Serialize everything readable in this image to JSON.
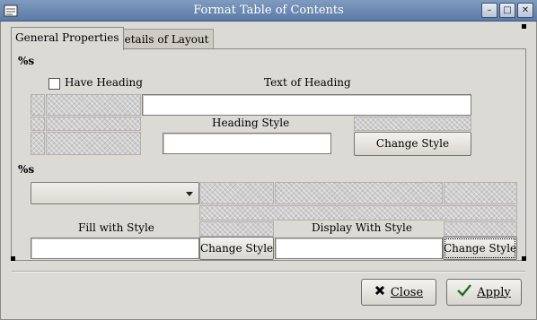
{
  "window": {
    "title": "Format Table of Contents",
    "minimize_glyph": "–",
    "maximize_glyph": "□",
    "close_glyph": "✕"
  },
  "tabs": [
    {
      "label": "General Properties",
      "active": true
    },
    {
      "label": "Details of Layout",
      "active": false
    }
  ],
  "heading_section": {
    "title": "%s",
    "have_heading_label": "Have Heading",
    "have_heading_checked": false,
    "text_of_heading_label": "Text of Heading",
    "text_of_heading_value": "",
    "heading_style_label": "Heading Style",
    "heading_style_value": "",
    "change_style_label": "Change Style"
  },
  "level_section": {
    "title": "%s",
    "level_selected": "",
    "fill_with_style_label": "Fill with Style",
    "fill_with_style_value": "",
    "fill_change_style_label": "Change Style",
    "display_with_style_label": "Display With Style",
    "display_with_style_value": "",
    "display_change_style_label": "Change Style"
  },
  "buttons": {
    "close_label": "Close",
    "apply_label": "Apply"
  },
  "icons": {
    "close": "close-x-icon",
    "apply": "checkmark-icon",
    "dropdown": "triangle-down-icon"
  }
}
